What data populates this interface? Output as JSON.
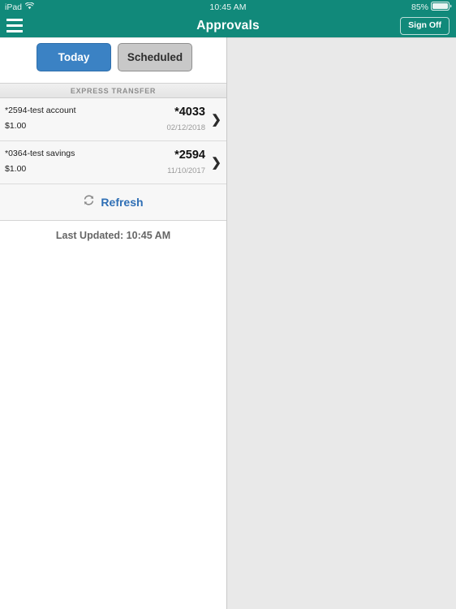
{
  "status_bar": {
    "device": "iPad",
    "wifi_icon": "wifi-icon",
    "time": "10:45 AM",
    "battery_percent": "85%",
    "battery_icon": "battery-icon"
  },
  "nav_bar": {
    "menu_icon": "hamburger-menu-icon",
    "title": "Approvals",
    "sign_off_label": "Sign Off"
  },
  "segmented_control": {
    "today_label": "Today",
    "scheduled_label": "Scheduled",
    "selected": "Today",
    "active_color": "#3b82c4",
    "inactive_color": "#c8c8c8"
  },
  "section": {
    "header": "EXPRESS TRANSFER"
  },
  "rows": [
    {
      "title": "*2594-test account",
      "amount": "$1.00",
      "account": "*4033",
      "date": "02/12/2018",
      "chevron_icon": "chevron-right-icon"
    },
    {
      "title": "*0364-test savings",
      "amount": "$1.00",
      "account": "*2594",
      "date": "11/10/2017",
      "chevron_icon": "chevron-right-icon"
    }
  ],
  "refresh": {
    "icon": "refresh-icon",
    "label": "Refresh",
    "color": "#2f6fb5"
  },
  "last_updated": {
    "text": "Last Updated: 10:45 AM"
  },
  "theme": {
    "nav_teal": "#11897a",
    "detail_background": "#e9e9e9"
  }
}
